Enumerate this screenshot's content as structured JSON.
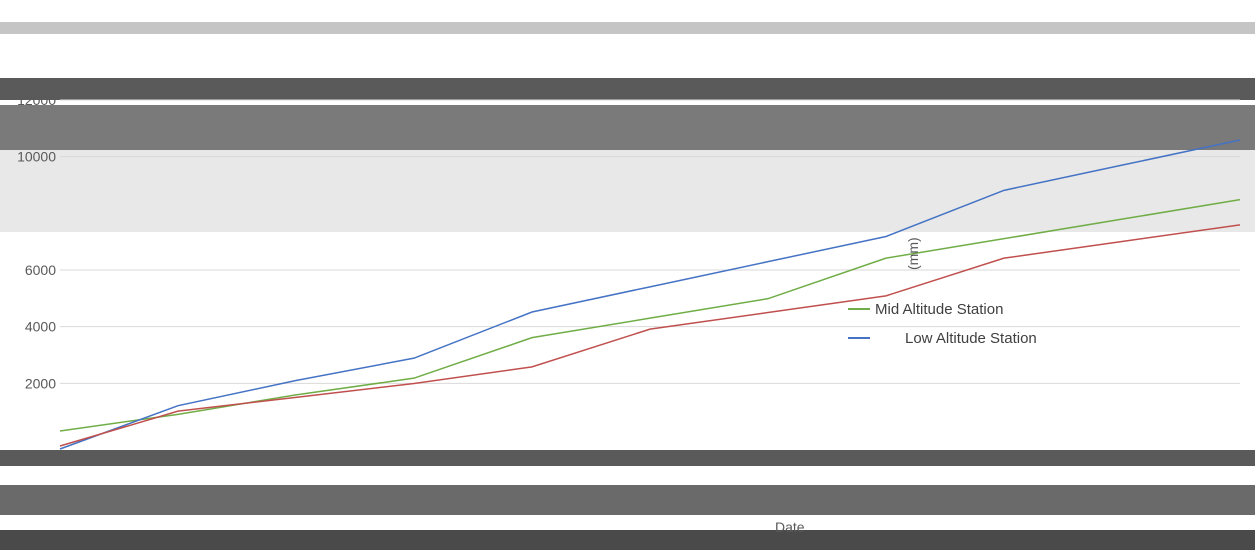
{
  "colors": {
    "low": "#4472c4",
    "mid": "#70ad47",
    "high": "#c0504d",
    "band_dark": "#5a5a5a",
    "band_light": "#d9d9d9",
    "grid": "#d9d9d9"
  },
  "chart_data": {
    "type": "line",
    "title": "",
    "xlabel": "Date",
    "ylabel": "(mm)",
    "ylim": [
      0,
      12000
    ],
    "yticks": [
      "2000",
      "4000",
      "6000",
      "10000",
      "12000"
    ],
    "legend_position": "right",
    "series": [
      {
        "name": "Mid Altitude Station",
        "color_key": "mid",
        "x": [
          0,
          1,
          2,
          3,
          4,
          5,
          6,
          7,
          8,
          9,
          10
        ],
        "values": [
          0,
          800,
          1700,
          2500,
          3400,
          4300,
          5200,
          6100,
          7000,
          7900,
          8800
        ]
      },
      {
        "name": "Low Altitude Station",
        "color_key": "low",
        "x": [
          0,
          1,
          2,
          3,
          4,
          5,
          6,
          7,
          8,
          9,
          10
        ],
        "values": [
          0,
          1000,
          2100,
          3100,
          4200,
          5300,
          6400,
          7500,
          8600,
          9700,
          10800
        ]
      },
      {
        "name": "",
        "color_key": "high",
        "x": [
          0,
          1,
          2,
          3,
          4,
          5,
          6,
          7,
          8,
          9,
          10
        ],
        "values": [
          0,
          700,
          1400,
          2100,
          2900,
          3700,
          4500,
          5300,
          6100,
          6900,
          7700
        ]
      }
    ]
  }
}
